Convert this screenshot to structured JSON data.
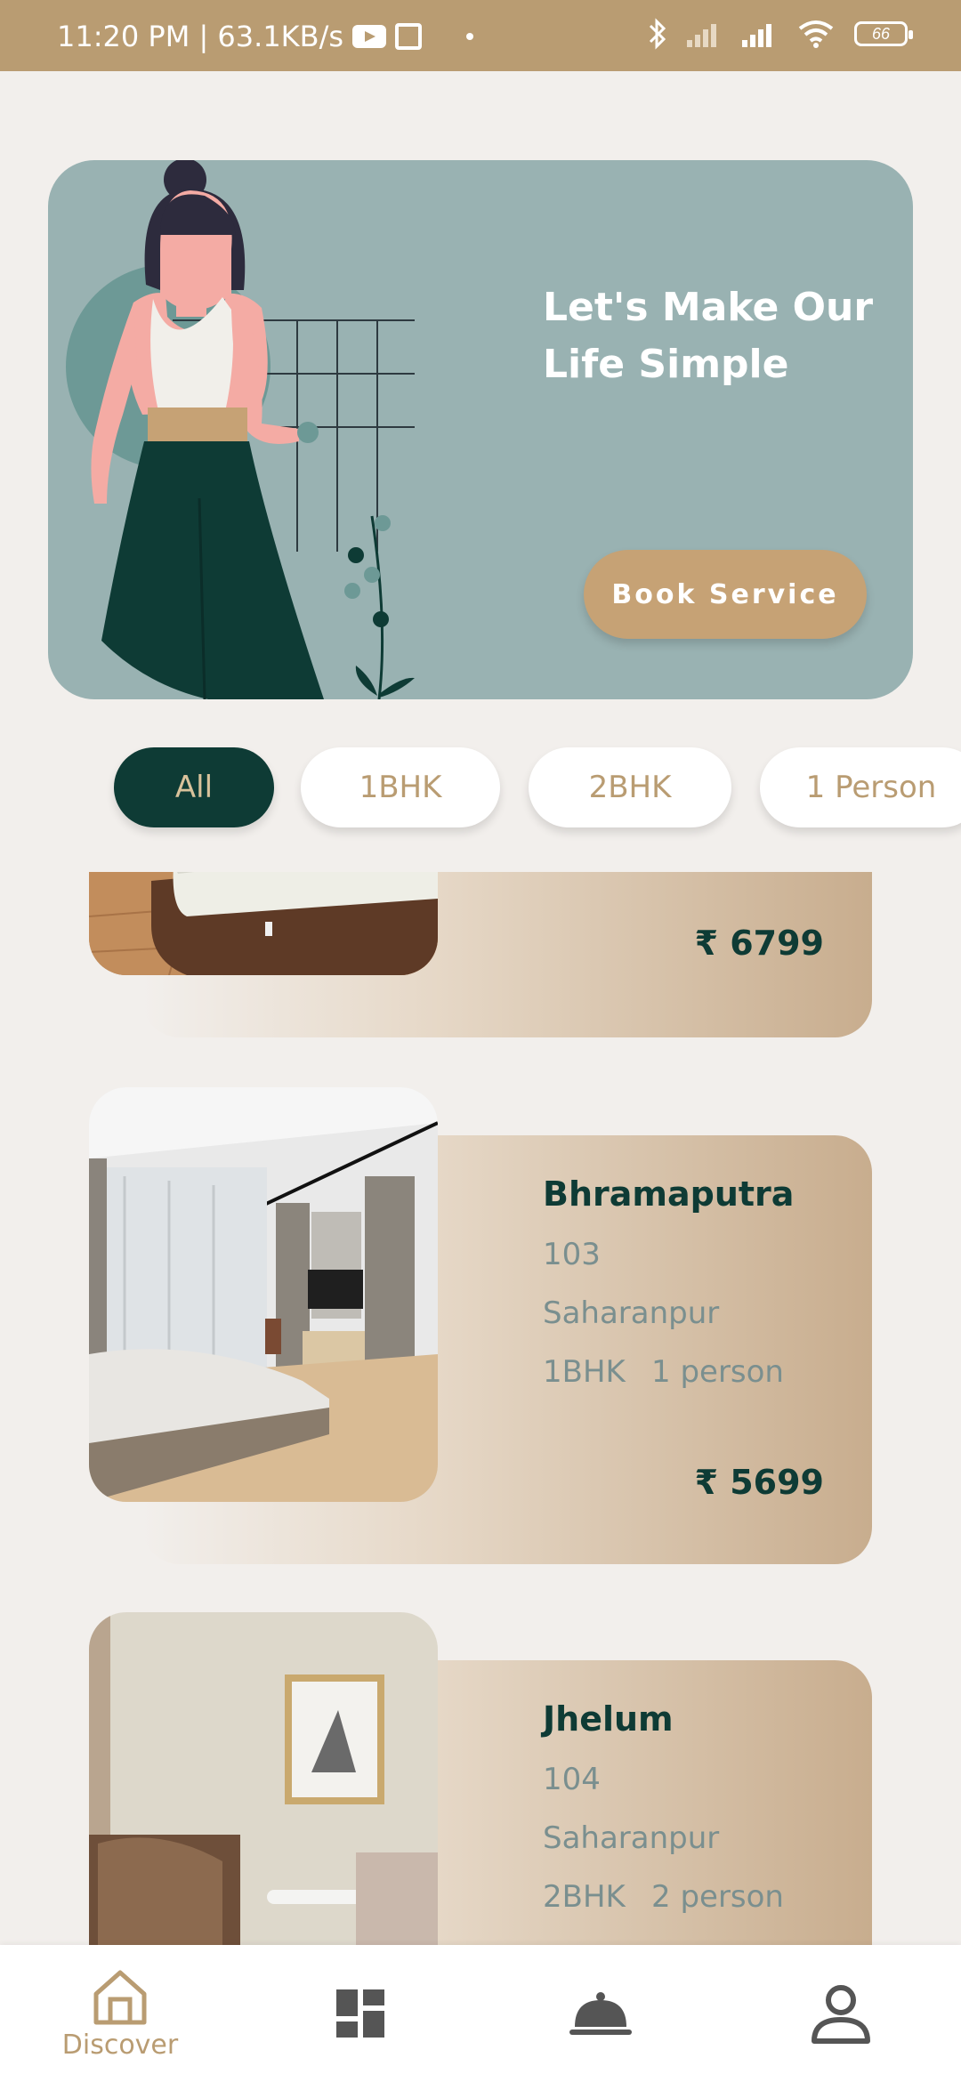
{
  "status_bar": {
    "time_speed": "11:20 PM | 63.1KB/s",
    "battery": "66"
  },
  "hero": {
    "title_line1": "Let's Make Our",
    "title_line2": "Life Simple",
    "button_label": "Book Service"
  },
  "filters": [
    "All",
    "1BHK",
    "2BHK",
    "1 Person"
  ],
  "cards": [
    {
      "price": "₹ 6799"
    },
    {
      "name": "Bhramaputra",
      "room": "103",
      "city": "Saharanpur",
      "type": "1BHK",
      "persons": "1 person",
      "price": "₹ 5699"
    },
    {
      "name": "Jhelum",
      "room": "104",
      "city": "Saharanpur",
      "type": "2BHK",
      "persons": "2 person"
    }
  ],
  "bottom_nav": {
    "discover_label": "Discover",
    "icons": [
      "home-icon",
      "dashboard-icon",
      "service-bell-icon",
      "profile-icon"
    ]
  },
  "colors": {
    "accent": "#b99c72",
    "dark_green": "#0e3b35",
    "hero_bg": "#99b2b2"
  }
}
